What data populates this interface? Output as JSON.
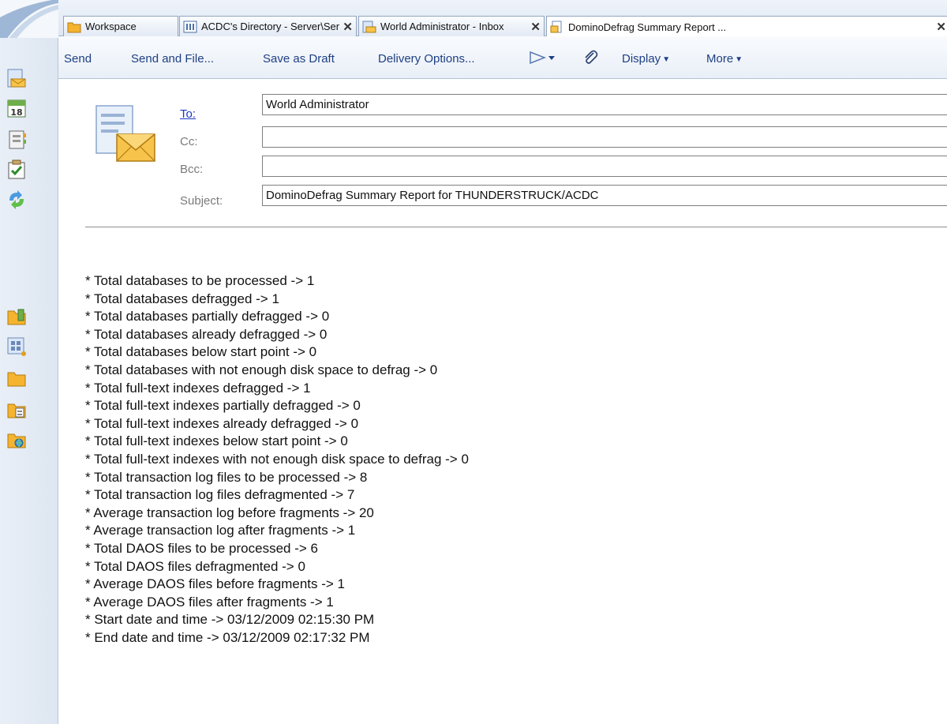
{
  "tabs": [
    {
      "label": "Workspace",
      "icon": "folder-icon",
      "closable": false
    },
    {
      "label": "ACDC's Directory - Server\\Serve ...",
      "icon": "directory-icon",
      "closable": true
    },
    {
      "label": "World Administrator - Inbox",
      "icon": "inbox-icon",
      "closable": true
    },
    {
      "label": "DominoDefrag Summary Report ...",
      "icon": "memo-icon",
      "closable": true,
      "active": true
    }
  ],
  "tab_close_glyph": "✕",
  "actions": {
    "send": "Send",
    "send_and_file": "Send and File...",
    "save_as_draft": "Save as Draft",
    "delivery_options": "Delivery Options...",
    "display": "Display",
    "more": "More"
  },
  "header": {
    "to_label": "To:",
    "to_value": "World Administrator",
    "cc_label": "Cc:",
    "cc_value": "",
    "bcc_label": "Bcc:",
    "bcc_value": "",
    "subject_label": "Subject:",
    "subject_value": "DominoDefrag Summary Report for THUNDERSTRUCK/ACDC"
  },
  "body_lines": [
    "* Total databases to be processed -> 1",
    "* Total databases defragged -> 1",
    "* Total databases partially defragged -> 0",
    "* Total databases already defragged -> 0",
    "* Total databases below start point -> 0",
    "* Total databases with not enough disk space to defrag -> 0",
    "* Total full-text indexes defragged -> 1",
    "* Total full-text indexes partially defragged -> 0",
    "* Total full-text indexes already defragged -> 0",
    "* Total full-text indexes below start point -> 0",
    "* Total full-text indexes with not enough disk space to defrag -> 0",
    "* Total transaction log files to be processed -> 8",
    "* Total transaction log files defragmented -> 7",
    "* Average transaction log before fragments -> 20",
    "* Average transaction log after fragments -> 1",
    "* Total DAOS files to be processed -> 6",
    "* Total DAOS files defragmented -> 0",
    "* Average DAOS files before fragments -> 1",
    "* Average DAOS files after fragments -> 1",
    "* Start date and time -> 03/12/2009 02:15:30 PM",
    "* End date and time -> 03/12/2009 02:17:32 PM"
  ],
  "left_icons": [
    "mail-icon",
    "calendar-icon",
    "contacts-icon",
    "todo-icon",
    "replication-icon",
    "bookmark-folder-icon",
    "applications-icon",
    "folder-icon",
    "favorites-icon",
    "internet-folder-icon"
  ],
  "calendar_day": "18",
  "colors": {
    "link": "#1a38c4",
    "action_text": "#1e3f83",
    "label_gray": "#7a7a7a",
    "folder_orange": "#f5a623",
    "leftbar_bg": "#e2e9f3"
  }
}
